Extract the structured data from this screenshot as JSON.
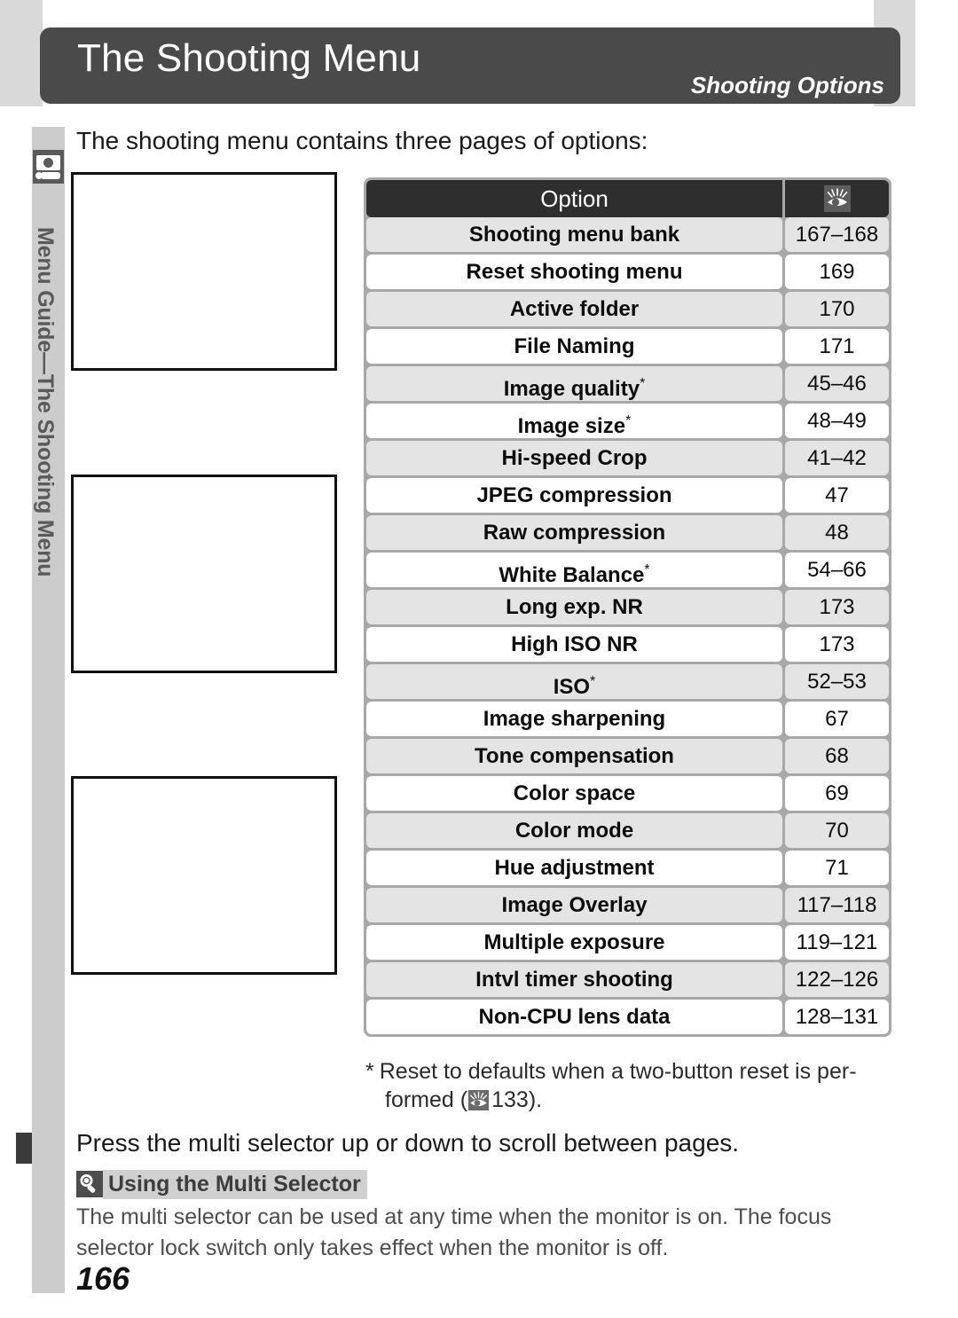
{
  "header": {
    "title": "The Shooting Menu",
    "subtitle": "Shooting Options"
  },
  "sidebar": {
    "icon": "camera-icon",
    "vertical_label": "Menu Guide—The Shooting Menu"
  },
  "intro": {
    "text": "The shooting menu contains three pages of options:"
  },
  "screenshots": [
    {
      "caption": ""
    },
    {
      "caption": ""
    },
    {
      "caption": ""
    }
  ],
  "table": {
    "headers": {
      "option": "Option",
      "page_icon": "eye-reference-icon"
    },
    "rows": [
      {
        "option": "Shooting menu bank",
        "star": false,
        "pages": "167–168"
      },
      {
        "option": "Reset shooting menu",
        "star": false,
        "pages": "169"
      },
      {
        "option": "Active folder",
        "star": false,
        "pages": "170"
      },
      {
        "option": "File Naming",
        "star": false,
        "pages": "171"
      },
      {
        "option": "Image quality",
        "star": true,
        "pages": "45–46"
      },
      {
        "option": "Image size",
        "star": true,
        "pages": "48–49"
      },
      {
        "option": "Hi-speed Crop",
        "star": false,
        "pages": "41–42"
      },
      {
        "option": "JPEG compression",
        "star": false,
        "pages": "47"
      },
      {
        "option": "Raw compression",
        "star": false,
        "pages": "48"
      },
      {
        "option": "White Balance",
        "star": true,
        "pages": "54–66"
      },
      {
        "option": "Long exp. NR",
        "star": false,
        "pages": "173"
      },
      {
        "option": "High ISO NR",
        "star": false,
        "pages": "173"
      },
      {
        "option": "ISO",
        "star": true,
        "pages": "52–53"
      },
      {
        "option": "Image sharpening",
        "star": false,
        "pages": "67"
      },
      {
        "option": "Tone compensation",
        "star": false,
        "pages": "68"
      },
      {
        "option": "Color space",
        "star": false,
        "pages": "69"
      },
      {
        "option": "Color mode",
        "star": false,
        "pages": "70"
      },
      {
        "option": "Hue adjustment",
        "star": false,
        "pages": "71"
      },
      {
        "option": "Image Overlay",
        "star": false,
        "pages": "117–118"
      },
      {
        "option": "Multiple exposure",
        "star": false,
        "pages": "119–121"
      },
      {
        "option": "Intvl timer shooting",
        "star": false,
        "pages": "122–126"
      },
      {
        "option": "Non-CPU lens data",
        "star": false,
        "pages": "128–131"
      }
    ]
  },
  "footnote": {
    "marker": "*",
    "part1": "Reset to defaults when a two-button reset is per-",
    "part2_pre": "formed (",
    "part2_page": "133",
    "part2_post": ")."
  },
  "press_line": {
    "text": "Press the multi selector up or down to scroll between pages."
  },
  "tip": {
    "icon": "magnifier-tip-icon",
    "title": "Using the Multi Selector",
    "body": "The multi selector can be used at any time when the monitor is on.  The focus selector lock switch only takes effect when the monitor is off."
  },
  "page_number": "166"
}
